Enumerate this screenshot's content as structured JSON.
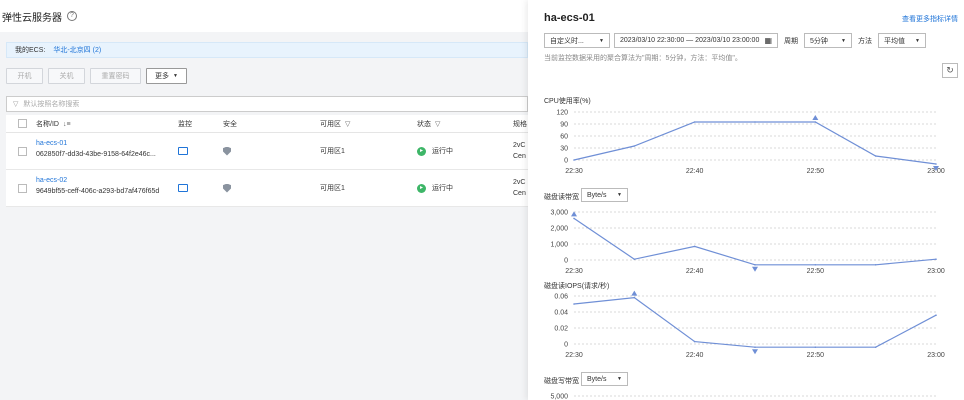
{
  "page": {
    "title": "弹性云服务器",
    "region_label": "我的ECS:",
    "region_value": "华北-北京四 (2)",
    "toolbar": {
      "start": "开机",
      "stop": "关机",
      "reset_pwd": "重置密码",
      "more": "更多"
    },
    "filter_placeholder": "默认按照名称搜索"
  },
  "table": {
    "columns": {
      "name": "名称/ID",
      "monitor": "监控",
      "security": "安全",
      "az": "可用区",
      "status": "状态",
      "spec": "规格"
    },
    "rows": [
      {
        "name": "ha-ecs-01",
        "id": "062850f7-dd3d-43be-9158-64f2e46c...",
        "az": "可用区1",
        "status": "运行中",
        "spec1": "2vC",
        "spec2": "Cen"
      },
      {
        "name": "ha-ecs-02",
        "id": "9649bf55-ceff-406c-a293-bd7af476f65d",
        "az": "可用区1",
        "status": "运行中",
        "spec1": "2vC",
        "spec2": "Cen"
      }
    ]
  },
  "panel": {
    "title": "ha-ecs-01",
    "more_link": "查看更多指标详情",
    "range_select": "自定义时...",
    "datetime": "2023/03/10 22:30:00 — 2023/03/10 23:00:00",
    "period_label": "周期",
    "period_value": "5分钟",
    "method_label": "方法",
    "method_value": "平均值",
    "hint": "当前监控数据采用的聚合算法为\"周期：5分钟，方法：平均值\"。"
  },
  "icons": {
    "help": "help-icon",
    "refresh": "refresh-icon",
    "calendar": "calendar-icon",
    "monitor": "monitor-icon",
    "shield": "shield-icon"
  },
  "colors": {
    "accent": "#1f74d8",
    "line": "#6f8fd6",
    "running": "#3eb668"
  },
  "chart_data": [
    {
      "type": "line",
      "title": "CPU使用率(%)",
      "x": [
        "22:30",
        "22:35",
        "22:40",
        "22:45",
        "22:50",
        "22:55",
        "23:00"
      ],
      "series": [
        {
          "values": [
            0,
            35,
            95,
            95,
            95,
            10,
            -10
          ]
        }
      ],
      "yticks": [
        "120",
        "90",
        "60",
        "30",
        "0"
      ],
      "xticks": [
        "22:30",
        "22:40",
        "22:50",
        "23:00"
      ],
      "ylim": [
        0,
        120
      ],
      "max_index": 4,
      "min_index": 6
    },
    {
      "type": "line",
      "title": "磁盘读带宽",
      "unit": "Byte/s",
      "x": [
        "22:30",
        "22:35",
        "22:40",
        "22:45",
        "22:50",
        "22:55",
        "23:00"
      ],
      "series": [
        {
          "values": [
            2600,
            50,
            850,
            -300,
            -300,
            -300,
            50
          ]
        }
      ],
      "yticks": [
        "3,000",
        "2,000",
        "1,000",
        "0"
      ],
      "xticks": [
        "22:30",
        "22:40",
        "22:50",
        "23:00"
      ],
      "ylim": [
        0,
        3000
      ],
      "max_index": 0,
      "min_index": 3
    },
    {
      "type": "line",
      "title": "磁盘读IOPS(请求/秒)",
      "x": [
        "22:30",
        "22:35",
        "22:40",
        "22:45",
        "22:50",
        "22:55",
        "23:00"
      ],
      "series": [
        {
          "values": [
            0.05,
            0.058,
            0.003,
            -0.004,
            -0.004,
            -0.004,
            0.036
          ]
        }
      ],
      "yticks": [
        "0.06",
        "0.04",
        "0.02",
        "0"
      ],
      "xticks": [
        "22:30",
        "22:40",
        "22:50",
        "23:00"
      ],
      "ylim": [
        0,
        0.06
      ],
      "max_index": 1,
      "min_index": 3
    },
    {
      "type": "line",
      "title": "磁盘写带宽",
      "unit": "Byte/s",
      "x": [],
      "series": [],
      "yticks": [
        "5,000"
      ],
      "xticks": [],
      "ylim": [
        0,
        5000
      ]
    }
  ]
}
